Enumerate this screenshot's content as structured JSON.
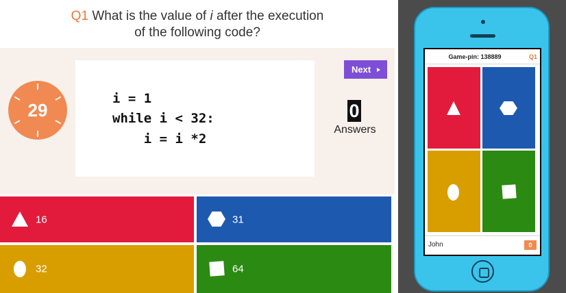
{
  "question": {
    "number": "Q1",
    "text_line1": "What is the value of i after the execution",
    "text_line1_pre": "What is the value of",
    "text_line1_var": "i",
    "text_line1_post": "after the execution",
    "text_line2": "of the following code?"
  },
  "timer": {
    "seconds": "29"
  },
  "code": {
    "lines": [
      "i = 1",
      "while i < 32:",
      "    i = i *2"
    ]
  },
  "controls": {
    "next_label": "Next"
  },
  "answers_counter": {
    "count": "0",
    "label": "Answers"
  },
  "answers": [
    {
      "color": "#e21b3c",
      "shape": "triangle-icon",
      "text": "16"
    },
    {
      "color": "#1e59b0",
      "shape": "hexagon-icon",
      "text": "31"
    },
    {
      "color": "#d89e00",
      "shape": "circle-icon",
      "text": "32"
    },
    {
      "color": "#2b8a12",
      "shape": "square-icon",
      "text": "64"
    }
  ],
  "phone": {
    "game_pin": "Game-pin: 138889",
    "question_indicator": "Q1",
    "player_name": "John",
    "player_score": "0",
    "body_color": "#3ac4ec"
  },
  "colors": {
    "accent_orange": "#e8773a",
    "next_purple": "#7e4fd6",
    "stage_background": "#f8f0eb"
  }
}
